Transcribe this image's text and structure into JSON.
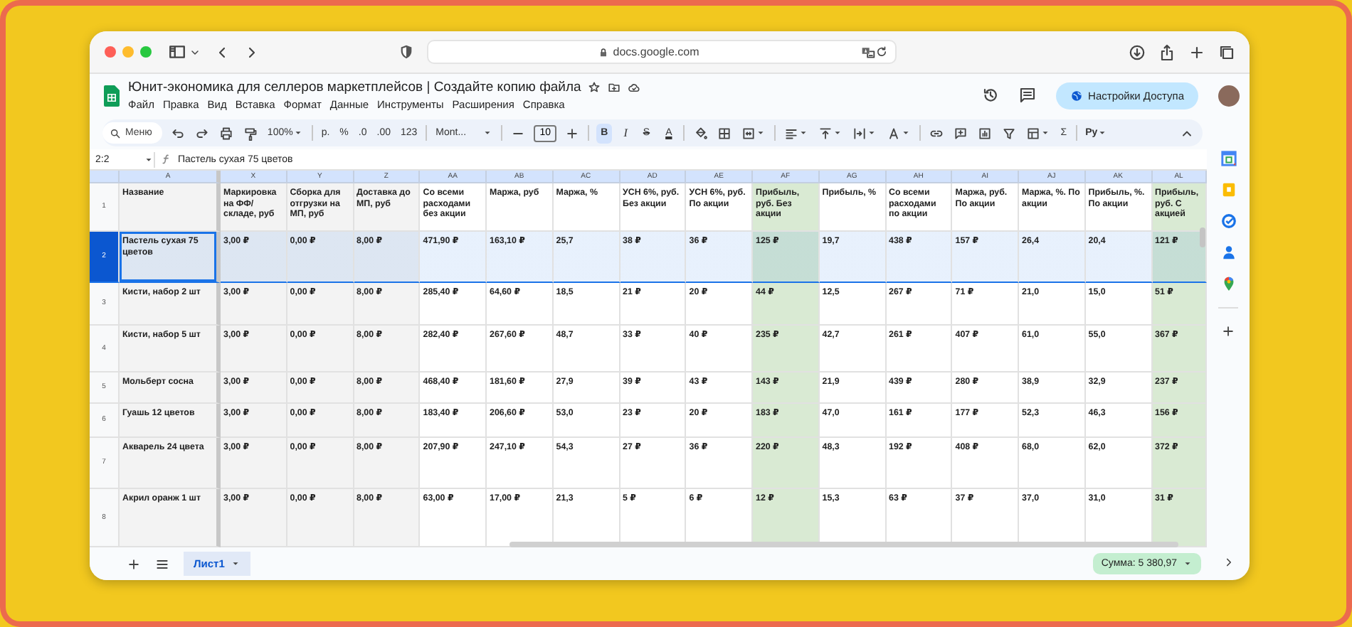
{
  "browser": {
    "url": "docs.google.com"
  },
  "document": {
    "title": "Юнит-экономика для селлеров маркетплейсов | Создайте копию файла",
    "menu": [
      "Файл",
      "Правка",
      "Вид",
      "Вставка",
      "Формат",
      "Данные",
      "Инструменты",
      "Расширения",
      "Справка"
    ],
    "share_button": "Настройки Доступа"
  },
  "toolbar": {
    "search": "Меню",
    "zoom": "100%",
    "number_formats": [
      "р.",
      "%",
      ".0",
      ".00",
      "123"
    ],
    "font": "Mont...",
    "font_size": "10",
    "styles": [
      {
        "label": "B",
        "on": true
      },
      {
        "label": "I",
        "on": false
      },
      {
        "label": "S",
        "on": false
      },
      {
        "label": "A",
        "on": false
      }
    ],
    "sum_symbol": "Σ",
    "input_tools": "Ру"
  },
  "formula_bar": {
    "cell_ref": "2:2",
    "content": "Пастель сухая 75 цветов"
  },
  "sheet": {
    "header_row_number": "1",
    "columns": [
      {
        "letter": "A",
        "header": "Название",
        "color": "#f3f3f3"
      },
      {
        "letter": "X",
        "header": "Маркировка на ФФ/складе, руб",
        "color": "#f3f3f3"
      },
      {
        "letter": "Y",
        "header": "Сборка для отгрузки на МП, руб",
        "color": "#f3f3f3"
      },
      {
        "letter": "Z",
        "header": "Доставка до МП, руб",
        "color": "#f3f3f3"
      },
      {
        "letter": "AA",
        "header": "Со всеми расходами без акции",
        "color": "#ffffff"
      },
      {
        "letter": "AB",
        "header": "Маржа, руб",
        "color": "#ffffff"
      },
      {
        "letter": "AC",
        "header": "Маржа, %",
        "color": "#ffffff"
      },
      {
        "letter": "AD",
        "header": "УСН 6%, руб. Без акции",
        "color": "#ffffff"
      },
      {
        "letter": "AE",
        "header": "УСН 6%, руб. По акции",
        "color": "#ffffff"
      },
      {
        "letter": "AF",
        "header": "Прибыль, руб. Без акции",
        "color": "#d9ead3"
      },
      {
        "letter": "AG",
        "header": "Прибыль, %",
        "color": "#ffffff"
      },
      {
        "letter": "AH",
        "header": "Со всеми расходами по акции",
        "color": "#ffffff"
      },
      {
        "letter": "AI",
        "header": "Маржа, руб. По акции",
        "color": "#ffffff"
      },
      {
        "letter": "AJ",
        "header": "Маржа, %. По акции",
        "color": "#ffffff"
      },
      {
        "letter": "AK",
        "header": "Прибыль, %. По акции",
        "color": "#ffffff"
      },
      {
        "letter": "AL",
        "header": "Прибыль, руб. С акцией",
        "color": "#d9ead3"
      }
    ],
    "rows": [
      {
        "number": "2",
        "selected": true,
        "cells": [
          "Пастель сухая 75 цветов",
          "3,00 ₽",
          "0,00 ₽",
          "8,00 ₽",
          "471,90 ₽",
          "163,10 ₽",
          "25,7",
          "38 ₽",
          "36 ₽",
          "125 ₽",
          "19,7",
          "438 ₽",
          "157 ₽",
          "26,4",
          "20,4",
          "121 ₽"
        ]
      },
      {
        "number": "3",
        "selected": false,
        "cells": [
          "Кисти, набор 2 шт",
          "3,00 ₽",
          "0,00 ₽",
          "8,00 ₽",
          "285,40 ₽",
          "64,60 ₽",
          "18,5",
          "21 ₽",
          "20 ₽",
          "44 ₽",
          "12,5",
          "267 ₽",
          "71 ₽",
          "21,0",
          "15,0",
          "51 ₽"
        ]
      },
      {
        "number": "4",
        "selected": false,
        "cells": [
          "Кисти, набор 5 шт",
          "3,00 ₽",
          "0,00 ₽",
          "8,00 ₽",
          "282,40 ₽",
          "267,60 ₽",
          "48,7",
          "33 ₽",
          "40 ₽",
          "235 ₽",
          "42,7",
          "261 ₽",
          "407 ₽",
          "61,0",
          "55,0",
          "367 ₽"
        ]
      },
      {
        "number": "5",
        "selected": false,
        "cells": [
          "Мольберт сосна",
          "3,00 ₽",
          "0,00 ₽",
          "8,00 ₽",
          "468,40 ₽",
          "181,60 ₽",
          "27,9",
          "39 ₽",
          "43 ₽",
          "143 ₽",
          "21,9",
          "439 ₽",
          "280 ₽",
          "38,9",
          "32,9",
          "237 ₽"
        ]
      },
      {
        "number": "6",
        "selected": false,
        "cells": [
          "Гуашь 12 цветов",
          "3,00 ₽",
          "0,00 ₽",
          "8,00 ₽",
          "183,40 ₽",
          "206,60 ₽",
          "53,0",
          "23 ₽",
          "20 ₽",
          "183 ₽",
          "47,0",
          "161 ₽",
          "177 ₽",
          "52,3",
          "46,3",
          "156 ₽"
        ]
      },
      {
        "number": "7",
        "selected": false,
        "cells": [
          "Акварель 24 цвета",
          "3,00 ₽",
          "0,00 ₽",
          "8,00 ₽",
          "207,90 ₽",
          "247,10 ₽",
          "54,3",
          "27 ₽",
          "36 ₽",
          "220 ₽",
          "48,3",
          "192 ₽",
          "408 ₽",
          "68,0",
          "62,0",
          "372 ₽"
        ]
      },
      {
        "number": "8",
        "selected": false,
        "cells": [
          "Акрил оранж 1 шт",
          "3,00 ₽",
          "0,00 ₽",
          "8,00 ₽",
          "63,00 ₽",
          "17,00 ₽",
          "21,3",
          "5 ₽",
          "6 ₽",
          "12 ₽",
          "15,3",
          "63 ₽",
          "37 ₽",
          "37,0",
          "31,0",
          "31 ₽"
        ]
      }
    ]
  },
  "bottom_bar": {
    "sheet_tabs": [
      {
        "label": "Лист1",
        "selected": true
      }
    ],
    "sum": "Сумма: 5 380,97"
  }
}
